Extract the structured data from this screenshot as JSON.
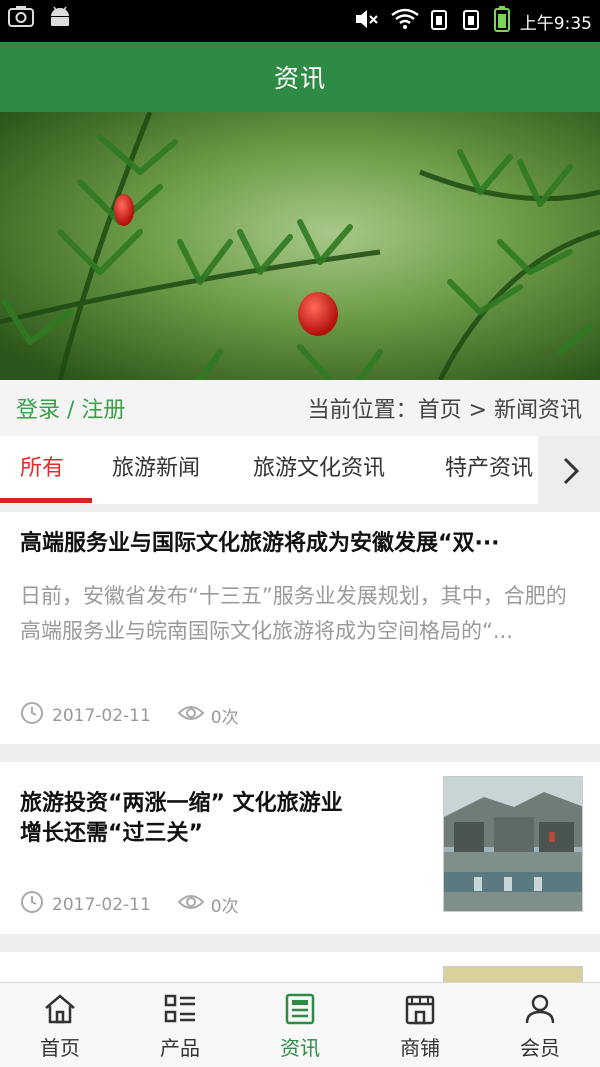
{
  "status_bar": {
    "time": "上午9:35"
  },
  "header": {
    "title": "资讯"
  },
  "info_bar": {
    "login": "登录 / 注册",
    "location": "当前位置：首页 > 新闻资讯"
  },
  "tabs": [
    {
      "label": "所有",
      "active": true
    },
    {
      "label": "旅游新闻",
      "active": false
    },
    {
      "label": "旅游文化资讯",
      "active": false
    },
    {
      "label": "特产资讯",
      "active": false
    }
  ],
  "articles": [
    {
      "title": "高端服务业与国际文化旅游将成为安徽发展“双···",
      "summary": "日前，安徽省发布“十三五”服务业发展规划，其中，合肥的高端服务业与皖南国际文化旅游将成为空间格局的“...",
      "date": "2017-02-11",
      "views": "0次"
    },
    {
      "title_line1": "旅游投资“两涨一缩” 文化旅游业",
      "title_line2": "增长还需“过三关”",
      "date": "2017-02-11",
      "views": "0次"
    }
  ],
  "bottom_nav": [
    {
      "label": "首页",
      "icon": "home-icon",
      "active": false
    },
    {
      "label": "产品",
      "icon": "list-icon",
      "active": false
    },
    {
      "label": "资讯",
      "icon": "news-icon",
      "active": true
    },
    {
      "label": "商铺",
      "icon": "shop-icon",
      "active": false
    },
    {
      "label": "会员",
      "icon": "user-icon",
      "active": false
    }
  ],
  "colors": {
    "brand_green": "#2e8b45",
    "active_tab_red": "#e22b2b",
    "login_green": "#3aa04a"
  }
}
